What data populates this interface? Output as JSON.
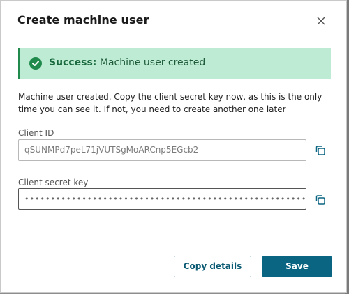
{
  "dialog": {
    "title": "Create machine user",
    "close_icon": "close-icon"
  },
  "alert": {
    "label": "Success:",
    "text": " Machine user created",
    "icon": "check-circle-icon",
    "color": "#1f8a4c",
    "background": "#bdebd3"
  },
  "message": "Machine user created. Copy the client secret key now, as this is the only time you can see it. If not, you need to create another one later",
  "client_id": {
    "label": "Client ID",
    "value": "qSUNMPd7peL71jVUTSgMoARCnp5EGcb2",
    "copy_icon": "copy-icon"
  },
  "client_secret": {
    "label": "Client secret key",
    "value": "••••••••••••••••••••••••••••••••••••••••••••••••••••••",
    "copy_icon": "copy-icon"
  },
  "buttons": {
    "copy_details": "Copy details",
    "save": "Save",
    "primary_color": "#0a6582"
  }
}
